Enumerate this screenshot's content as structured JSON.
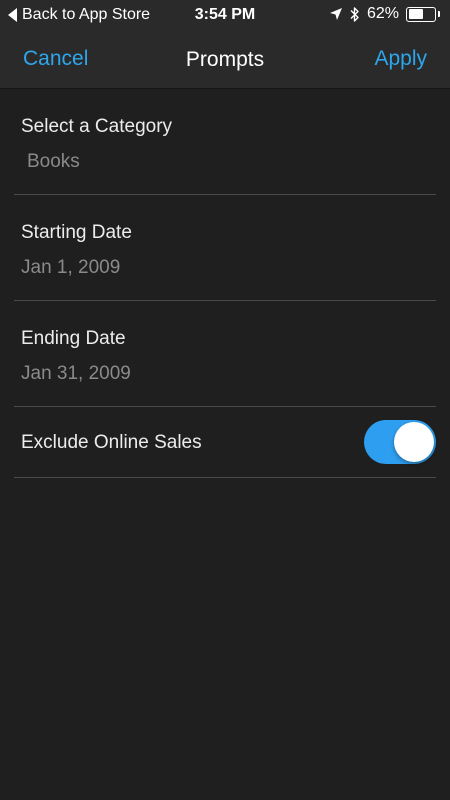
{
  "status_bar": {
    "back_label": "Back to App Store",
    "time": "3:54 PM",
    "battery_text": "62%",
    "battery_level": 0.62
  },
  "nav": {
    "cancel_label": "Cancel",
    "title": "Prompts",
    "apply_label": "Apply"
  },
  "form": {
    "category": {
      "label": "Select a Category",
      "value": "Books"
    },
    "starting_date": {
      "label": "Starting Date",
      "value": "Jan 1, 2009"
    },
    "ending_date": {
      "label": "Ending Date",
      "value": "Jan 31, 2009"
    },
    "exclude_online": {
      "label": "Exclude Online Sales",
      "enabled": true
    }
  },
  "colors": {
    "accent": "#2ea6ec",
    "toggle_on": "#2e9ff0",
    "background": "#1f1f1f"
  },
  "icons": [
    "back-arrow-icon",
    "location-arrow-icon",
    "bluetooth-icon",
    "battery-icon"
  ]
}
